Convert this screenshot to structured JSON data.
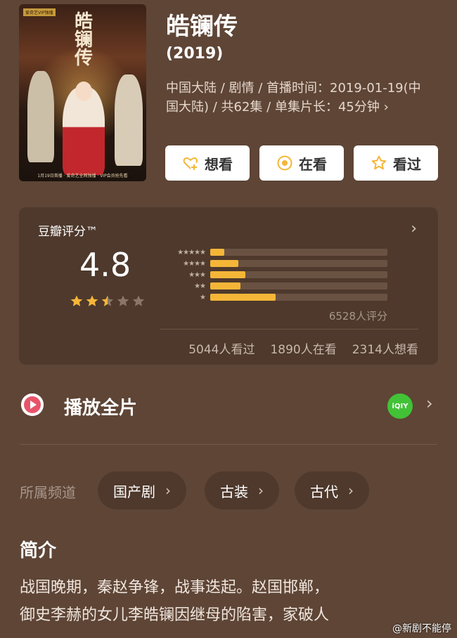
{
  "movie": {
    "title": "皓镧传",
    "year": "(2019)",
    "meta_line1": "中国大陆 / 剧情 / 首播时间：2019-01-19(中",
    "meta_line2": "国大陆) / 共62集 / 单集片长：45分钟 ›",
    "poster_title": "皓镧传",
    "poster_badge": "爱奇艺VIP独播",
    "poster_caption": "1月19日首播 · 爱奇艺全网独播 · VIP会员抢先看"
  },
  "actions": {
    "want": "想看",
    "watching": "在看",
    "watched": "看过"
  },
  "rating": {
    "label": "豆瓣评分™",
    "score": "4.8",
    "stars_filled": 2.5,
    "distribution": [
      {
        "label": "★★★★★",
        "fraction": 0.08
      },
      {
        "label": "★★★★",
        "fraction": 0.16
      },
      {
        "label": "★★★",
        "fraction": 0.2
      },
      {
        "label": "★★",
        "fraction": 0.17
      },
      {
        "label": "★",
        "fraction": 0.37
      }
    ],
    "total": "6528人评分",
    "watched_count": "5044人看过",
    "watching_count": "1890人在看",
    "want_count": "2314人想看"
  },
  "play": {
    "label": "播放全片",
    "provider": "iQIY"
  },
  "channels": {
    "label": "所属频道",
    "tags": [
      "国产剧",
      "古装",
      "古代"
    ]
  },
  "intro": {
    "title": "简介",
    "line1": "战国晚期，秦赵争锋，战事迭起。赵国邯郸，",
    "line2": "御史李赫的女儿李皓镧因继母的陷害，家破人"
  },
  "watermark": "@新剧不能停",
  "colors": {
    "background": "#5e4536",
    "card": "#4e392c",
    "star": "#f5b638",
    "iqiyi": "#42c236"
  }
}
